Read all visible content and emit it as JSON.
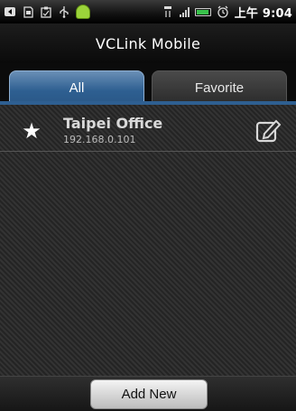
{
  "status_bar": {
    "time": "上午 9:04",
    "icons": [
      "back-icon",
      "sim-icon",
      "clipboard-icon",
      "usb-icon",
      "android-icon",
      "network-icon",
      "signal-icon",
      "battery-icon",
      "alarm-icon"
    ]
  },
  "app": {
    "title": "VCLink Mobile"
  },
  "tabs": [
    {
      "label": "All",
      "selected": true
    },
    {
      "label": "Favorite",
      "selected": false
    }
  ],
  "connections": [
    {
      "name": "Taipei Office",
      "address": "192.168.0.101",
      "favorite": true
    }
  ],
  "footer": {
    "add_label": "Add New"
  },
  "colors": {
    "tab_active": "#2e5f91",
    "background": "#2a2a2a"
  }
}
